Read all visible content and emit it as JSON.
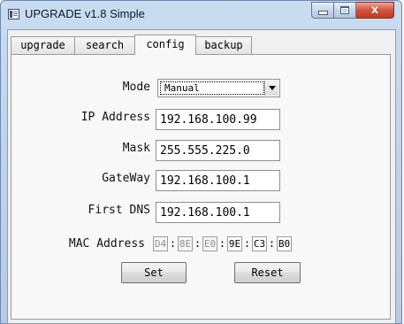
{
  "window": {
    "title": "UPGRADE v1.8 Simple",
    "close_glyph": "x"
  },
  "tabs": [
    {
      "label": "upgrade"
    },
    {
      "label": "search"
    },
    {
      "label": "config"
    },
    {
      "label": "backup"
    }
  ],
  "config": {
    "mode_label": "Mode",
    "mode_value": "Manual",
    "ip_label": "IP Address",
    "ip_value": "192.168.100.99",
    "mask_label": "Mask",
    "mask_value": "255.555.225.0",
    "gateway_label": "GateWay",
    "gateway_value": "192.168.100.1",
    "dns_label": "First DNS",
    "dns_value": "192.168.100.1",
    "mac_label": "MAC Address",
    "mac": [
      "D4",
      "8E",
      "E0",
      "9E",
      "C3",
      "B0"
    ],
    "mac_sep": ":",
    "set_label": "Set",
    "reset_label": "Reset"
  }
}
